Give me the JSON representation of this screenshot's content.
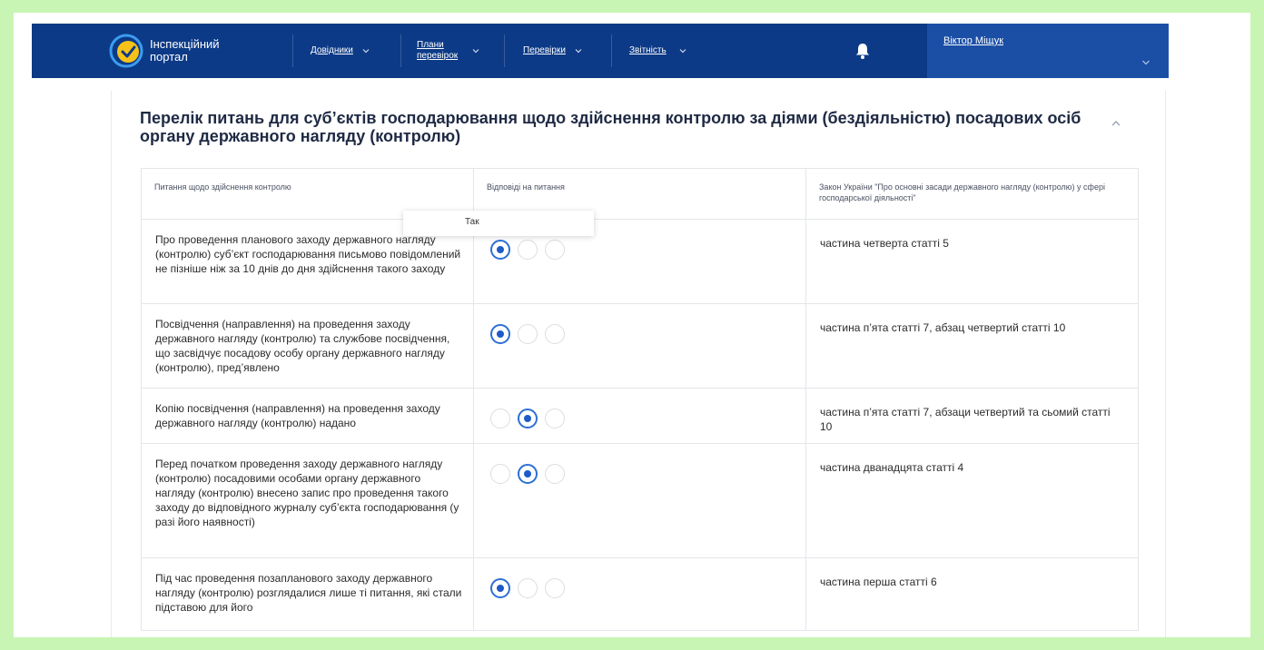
{
  "header": {
    "brand_line1": "Інспекційний",
    "brand_line2": "портал",
    "nav": [
      {
        "label": "Довідники"
      },
      {
        "label_line1": "Плани",
        "label_line2": "перевірок"
      },
      {
        "label": "Перевірки"
      },
      {
        "label": "Звітність"
      }
    ],
    "user_name": "Віктор Міщук"
  },
  "section": {
    "title": "Перелік питань для суб’єктів господарювання щодо здійснення контролю за діями (бездіяльністю) посадових осіб органу державного нагляду (контролю)"
  },
  "table": {
    "headers": {
      "question": "Питання щодо здійснення контролю",
      "answers": "Відповіді на питання",
      "law": "Закон України \"Про основні засади державного нагляду (контролю) у сфері господарської діяльності\""
    },
    "rows": [
      {
        "question": "Про проведення планового заходу державного нагляду (контролю) суб’єкт господарювання письмово повідомлений не пізніше ніж за 10 днів до дня здійснення такого заходу",
        "selected": 0,
        "law": "частина четверта статті 5"
      },
      {
        "question": "Посвідчення (направлення) на проведення заходу державного нагляду (контролю) та службове посвідчення, що засвідчує посадову особу органу державного нагляду (контролю), пред’явлено",
        "selected": 0,
        "law": "частина п’ята статті 7, абзац четвертий статті 10"
      },
      {
        "question": "Копію посвідчення (направлення) на проведення заходу державного нагляду (контролю) надано",
        "selected": 1,
        "law": "частина п’ята статті 7, абзаци четвертий та сьомий статті 10"
      },
      {
        "question": "Перед початком проведення заходу державного нагляду (контролю) посадовими особами органу державного нагляду (контролю) внесено запис про проведення такого заходу до відповідного журналу суб’єкта господарювання (у разі його наявності)",
        "selected": 1,
        "law": "частина дванадцята статті 4"
      },
      {
        "question": "Під час проведення позапланового заходу державного нагляду (контролю) розглядалися лише ті питання, які стали підставою для його",
        "selected": 0,
        "law": "частина перша статті 6"
      }
    ]
  },
  "tooltip": {
    "text": "Так"
  },
  "colors": {
    "header_bg": "#0c3a86",
    "user_bg": "#1b4fa6",
    "radio_accent": "#1e5bc8",
    "page_frame": "#c8f5b4"
  }
}
